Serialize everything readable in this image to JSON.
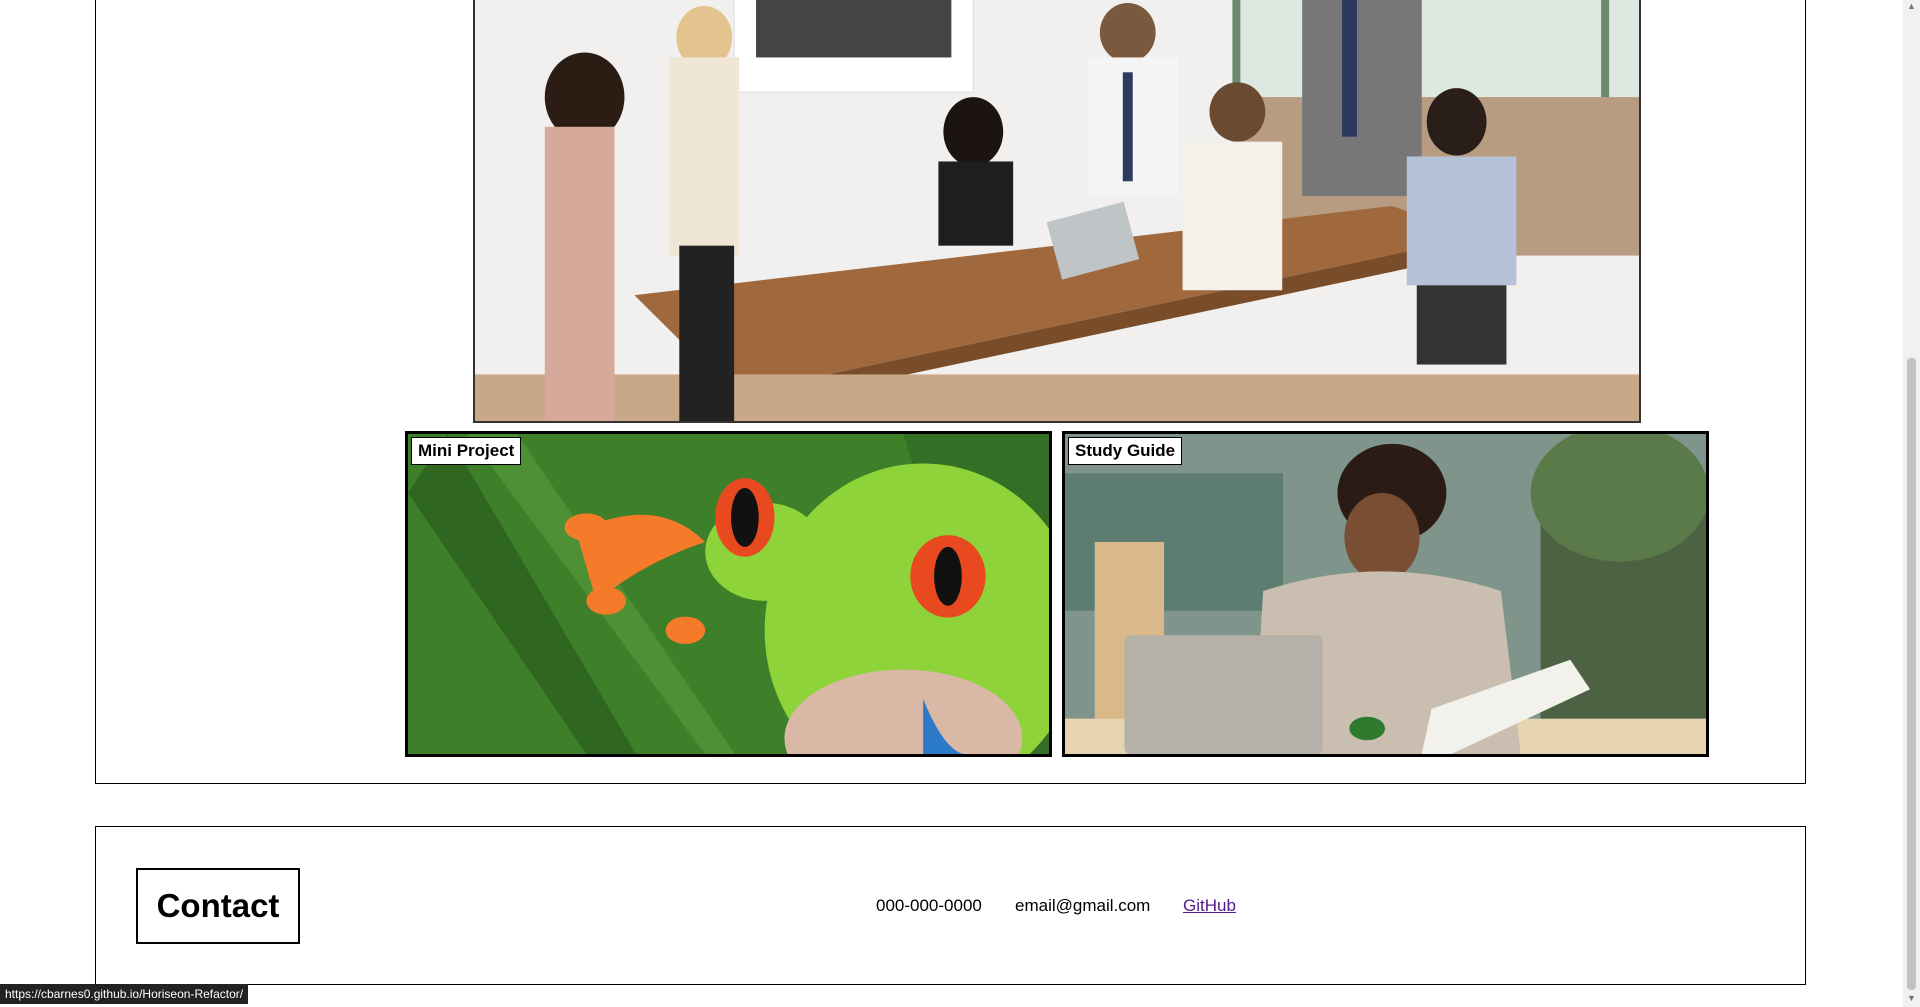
{
  "cards": {
    "left_label": "Mini Project",
    "right_label": "Study Guide"
  },
  "contact": {
    "title": "Contact",
    "phone": "000-000-0000",
    "email": "email@gmail.com",
    "github": "GitHub"
  },
  "status_bar": {
    "url": "https://cbarnes0.github.io/Horiseon-Refactor/"
  },
  "colors": {
    "link": "#551a8b",
    "border": "#000000"
  }
}
